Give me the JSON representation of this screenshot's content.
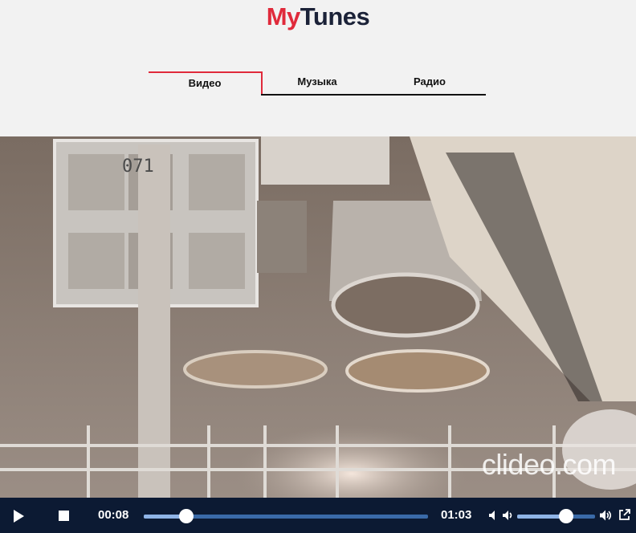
{
  "header": {
    "logo_part1": "My",
    "logo_part2": "Tunes"
  },
  "tabs": [
    {
      "label": "Видео",
      "active": true
    },
    {
      "label": "Музыка",
      "active": false
    },
    {
      "label": "Радио",
      "active": false
    }
  ],
  "player": {
    "watermark": "clideo.com",
    "current_time": "00:08",
    "duration": "01:03",
    "progress": 0.15,
    "volume": 0.63,
    "video_overlay_text": "071"
  },
  "colors": {
    "accent": "#e02a3b",
    "logo_dark": "#1b2238",
    "controls_bg": "#0c1a33",
    "track": "#3a6aa8"
  },
  "icons": [
    "play-icon",
    "stop-icon",
    "volume-mute-icon",
    "volume-low-icon",
    "volume-high-icon",
    "external-link-icon"
  ]
}
